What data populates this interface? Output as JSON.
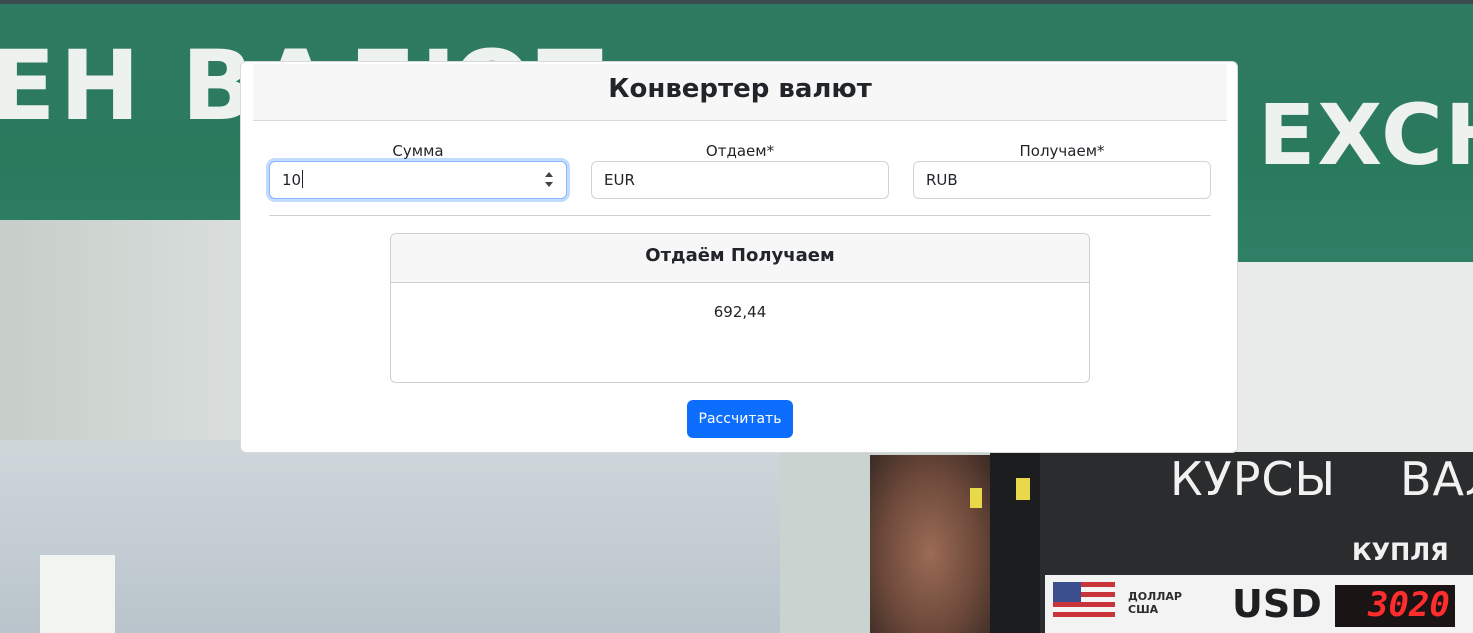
{
  "card": {
    "title": "Конвертер валют"
  },
  "fields": {
    "amount": {
      "label": "Сумма",
      "value": "10"
    },
    "from": {
      "label": "Отдаем*",
      "value": "EUR"
    },
    "to": {
      "label": "Получаем*",
      "value": "RUB"
    }
  },
  "result": {
    "title": "Отдаём Получаем",
    "value": "692,44"
  },
  "button": {
    "label": "Рассчитать"
  },
  "background": {
    "sign_left": "ЕН ВАЛЮТ",
    "sign_right": "EXCH",
    "board_title_1": "КУРСЫ",
    "board_title_2": "ВАЛ",
    "board_buy": "КУПЛЯ",
    "board_small_1": "ДОЛЛАР",
    "board_small_2": "США",
    "board_currency": "USD",
    "board_rate": "3020"
  },
  "colors": {
    "primary": "#0d6efd",
    "focus_border": "#86b7fe",
    "sign_green": "#2a7a5e"
  }
}
